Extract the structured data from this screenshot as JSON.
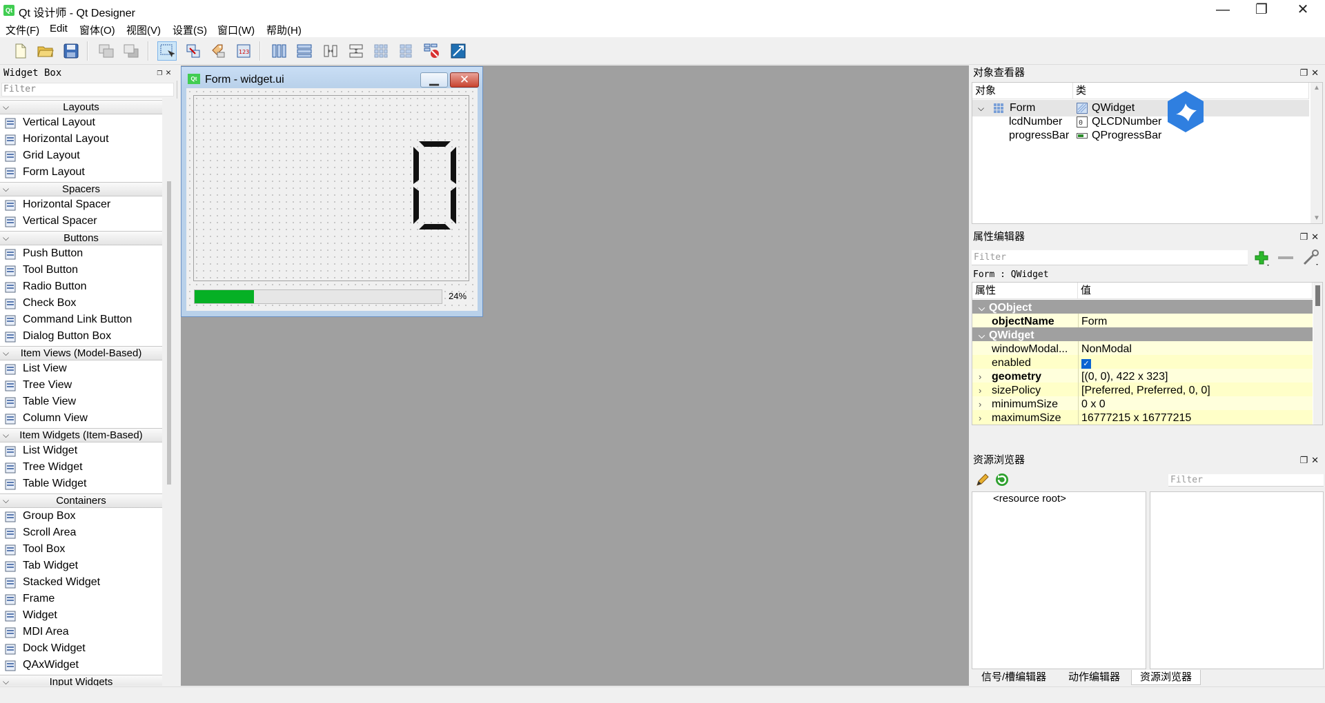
{
  "window": {
    "title": "Qt 设计师 - Qt Designer",
    "app_icon_text": "Qt",
    "minimize": "—",
    "restore": "❐",
    "close": "✕"
  },
  "menubar": {
    "items": [
      "文件(F)",
      "Edit",
      "窗体(O)",
      "视图(V)",
      "设置(S)",
      "窗口(W)",
      "帮助(H)"
    ]
  },
  "toolbar": {
    "buttons": [
      "new",
      "open",
      "save",
      "send-to-back",
      "bring-to-front",
      "edit-widgets",
      "edit-signals-slots",
      "edit-buddies",
      "edit-tab-order",
      "lay-out-horizontally",
      "lay-out-vertically",
      "lay-out-horizontally-splitter",
      "lay-out-vertically-splitter",
      "lay-out-grid",
      "lay-out-form",
      "break-layout",
      "adjust-size"
    ]
  },
  "form_window": {
    "title": "Form - widget.ui",
    "icon_text": "Qt",
    "lcd_value": "0",
    "progress_value": 0.24,
    "progress_label": "24%"
  },
  "widget_box": {
    "title": "Widget Box",
    "filter_placeholder": "Filter",
    "categories": [
      {
        "name": "Layouts",
        "items": [
          "Vertical Layout",
          "Horizontal Layout",
          "Grid Layout",
          "Form Layout"
        ]
      },
      {
        "name": "Spacers",
        "items": [
          "Horizontal Spacer",
          "Vertical Spacer"
        ]
      },
      {
        "name": "Buttons",
        "items": [
          "Push Button",
          "Tool Button",
          "Radio Button",
          "Check Box",
          "Command Link Button",
          "Dialog Button Box"
        ]
      },
      {
        "name": "Item Views (Model-Based)",
        "items": [
          "List View",
          "Tree View",
          "Table View",
          "Column View"
        ]
      },
      {
        "name": "Item Widgets (Item-Based)",
        "items": [
          "List Widget",
          "Tree Widget",
          "Table Widget"
        ]
      },
      {
        "name": "Containers",
        "items": [
          "Group Box",
          "Scroll Area",
          "Tool Box",
          "Tab Widget",
          "Stacked Widget",
          "Frame",
          "Widget",
          "MDI Area",
          "Dock Widget",
          "QAxWidget"
        ]
      },
      {
        "name": "Input Widgets",
        "items": []
      }
    ]
  },
  "object_inspector": {
    "title": "对象查看器",
    "col_object": "对象",
    "col_class": "类",
    "rows": [
      {
        "object": "Form",
        "class": "QWidget"
      },
      {
        "object": "lcdNumber",
        "class": "QLCDNumber"
      },
      {
        "object": "progressBar",
        "class": "QProgressBar"
      }
    ]
  },
  "property_editor": {
    "title": "属性编辑器",
    "filter_placeholder": "Filter",
    "context": "Form : QWidget",
    "col_property": "属性",
    "col_value": "值",
    "rows": [
      {
        "type": "group",
        "name": "QObject"
      },
      {
        "type": "prop",
        "name": "objectName",
        "value": "Form",
        "bold": true
      },
      {
        "type": "group",
        "name": "QWidget"
      },
      {
        "type": "prop",
        "name": "windowModal...",
        "value": "NonModal"
      },
      {
        "type": "prop",
        "name": "enabled",
        "value": "",
        "checkbox": true
      },
      {
        "type": "prop",
        "name": "geometry",
        "value": "[(0, 0), 422 x 323]",
        "bold": true,
        "expandable": true
      },
      {
        "type": "prop",
        "name": "sizePolicy",
        "value": "[Preferred, Preferred, 0, 0]",
        "expandable": true
      },
      {
        "type": "prop",
        "name": "minimumSize",
        "value": "0 x 0",
        "expandable": true
      },
      {
        "type": "prop",
        "name": "maximumSize",
        "value": "16777215 x 16777215",
        "expandable": true
      }
    ]
  },
  "resource_browser": {
    "title": "资源浏览器",
    "filter_placeholder": "Filter",
    "root": "<resource root>"
  },
  "bottom_tabs": [
    "信号/槽编辑器",
    "动作编辑器",
    "资源浏览器"
  ]
}
